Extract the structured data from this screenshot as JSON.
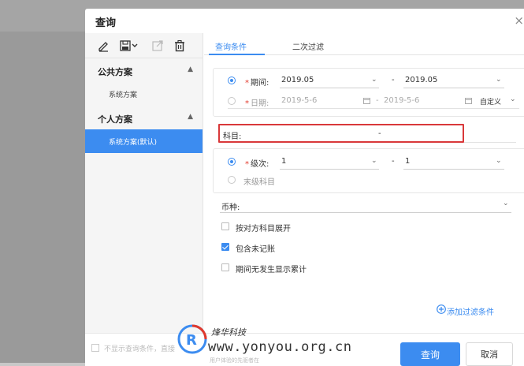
{
  "dialog": {
    "title": "查询",
    "close_glyph": "×"
  },
  "left": {
    "toolbar_icons": [
      "edit-icon",
      "save-icon",
      "export-icon",
      "delete-icon"
    ],
    "sections": [
      {
        "title": "公共方案",
        "items": [
          "系统方案"
        ]
      },
      {
        "title": "个人方案",
        "items": [
          "系统方案(默认)"
        ]
      }
    ],
    "collapse_icon": "chevron-left-circle-icon"
  },
  "tabs": [
    {
      "label": "查询条件",
      "active": true
    },
    {
      "label": "二次过滤",
      "active": false
    }
  ],
  "period": {
    "label": "期间:",
    "from": "2019.05",
    "dash": "-",
    "to": "2019.05"
  },
  "date": {
    "label": "日期:",
    "from": "2019-5-6",
    "dash": "-",
    "to": "2019-5-6",
    "range_option": "自定义"
  },
  "subject": {
    "label": "科目:",
    "dash": "-"
  },
  "level": {
    "label": "级次:",
    "from": "1",
    "dash": "-",
    "to": "1",
    "leaf_label": "末级科目"
  },
  "currency": {
    "label": "币种:"
  },
  "options": [
    {
      "label": "按对方科目展开",
      "checked": false
    },
    {
      "label": "包含未记账",
      "checked": true
    },
    {
      "label": "期间无发生显示累计",
      "checked": false
    }
  ],
  "add_filter": "添加过滤条件",
  "footer": {
    "hide_text": "不显示查询条件，直接",
    "query_button": "查询",
    "cancel_button": "取消"
  },
  "watermark": {
    "brand": "烽华科技",
    "url": "www.yonyou.org.cn",
    "sub": "用户体验的先驱者在"
  },
  "colors": {
    "accent": "#3c8cf0",
    "highlight_border": "#d9383a",
    "required": "#e2392c"
  }
}
